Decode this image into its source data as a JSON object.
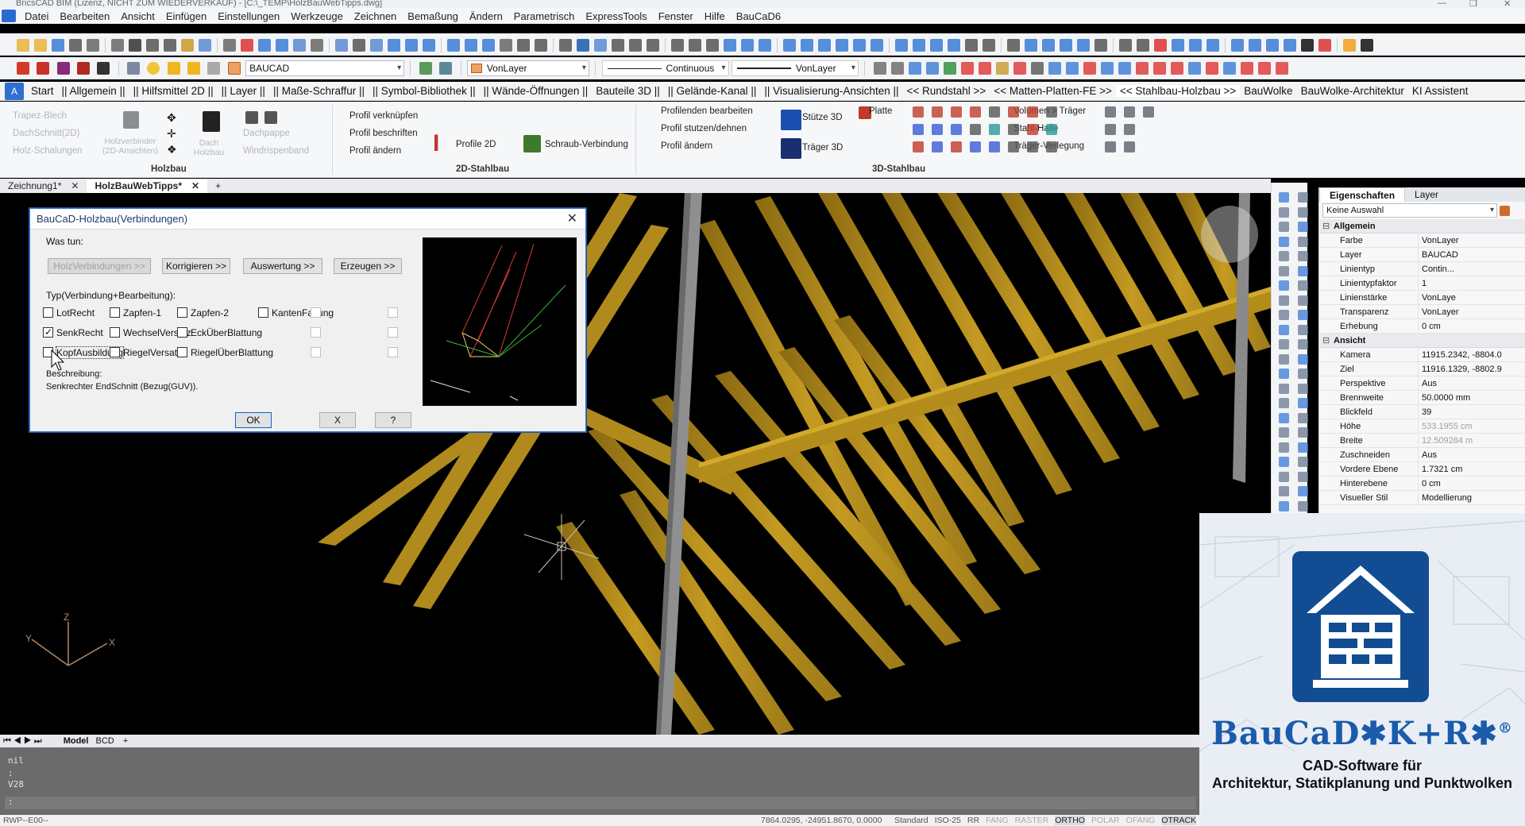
{
  "window": {
    "title": "BricsCAD BIM (Lizenz, NICHT ZUM WIEDERVERKAUF) - [C:\\_TEMP\\HolzBauWebTipps.dwg]"
  },
  "menu": [
    "Datei",
    "Bearbeiten",
    "Ansicht",
    "Einfügen",
    "Einstellungen",
    "Werkzeuge",
    "Zeichnen",
    "Bemaßung",
    "Ändern",
    "Parametrisch",
    "ExpressTools",
    "Fenster",
    "Hilfe",
    "BauCaD6"
  ],
  "toolbar2": {
    "layer": "BAUCAD",
    "color": "VonLayer",
    "linetype": "Continuous",
    "lineweight": "VonLayer"
  },
  "ribbon_tabs": [
    "Start",
    "|| Allgemein ||",
    "|| Hilfsmittel 2D ||",
    "|| Layer ||",
    "|| Maße-Schraffur ||",
    "|| Symbol-Bibliothek ||",
    "|| Wände-Öffnungen ||",
    "Bauteile 3D ||",
    "|| Gelände-Kanal ||",
    "|| Visualisierung-Ansichten ||",
    "<< Rundstahl >>",
    "<< Matten-Platten-FE >>",
    "<< Stahlbau-Holzbau >>",
    "BauWolke",
    "BauWolke-Architektur",
    "KI Assistent"
  ],
  "ribbon": {
    "holzbau": {
      "items": [
        "Trapez-Blech",
        "DachSchnitt(2D)",
        "Holz-Schalungen",
        "Holzverbinder (2D-Ansichten)",
        "Dach Holzbau",
        "Dachpappe",
        "Windrispenband"
      ],
      "group": "Holzbau"
    },
    "stahl2d": {
      "items": [
        "Profil verknüpfen",
        "Profil beschriften",
        "Profil ändern",
        "Profile 2D",
        "Schraub-Verbindung"
      ],
      "group": "2D-Stahlbau"
    },
    "stahl3d": {
      "items": [
        "Profilenden bearbeiten",
        "Profil stutzen/dehnen",
        "Profil ändern",
        "Stütze 3D",
        "Träger 3D",
        "Platte",
        "Volumen > Träger",
        "Stahl-Halle",
        "Träger-Verlegung"
      ],
      "group": "3D-Stahlbau"
    }
  },
  "doc_tabs": [
    {
      "label": "Zeichnung1*"
    },
    {
      "label": "HolzBauWebTipps*"
    }
  ],
  "dialog": {
    "title": "BauCaD-Holzbau(Verbindungen)",
    "was_tun": "Was tun:",
    "buttons": [
      "HolzVerbindungen >>",
      "Korrigieren >>",
      "Auswertung >>",
      "Erzeugen >>"
    ],
    "typ_label": "Typ(Verbindung+Bearbeitung):",
    "checks": [
      {
        "label": "LotRecht",
        "checked": false
      },
      {
        "label": "Zapfen-1",
        "checked": false
      },
      {
        "label": "Zapfen-2",
        "checked": false
      },
      {
        "label": "KantenFasung",
        "checked": false
      },
      {
        "label": "SenkRecht",
        "checked": true
      },
      {
        "label": "WechselVersatz",
        "checked": false
      },
      {
        "label": "EckÜberBlattung",
        "checked": false
      },
      {
        "label": "KopfAusbildung",
        "checked": false
      },
      {
        "label": "RiegelVersatz",
        "checked": false
      },
      {
        "label": "RiegelÜberBlattung",
        "checked": false
      }
    ],
    "beschreibung_label": "Beschreibung:",
    "beschreibung": "Senkrechter EndSchnitt (Bezug(GUV)).",
    "ok": "OK",
    "cancel": "X",
    "help": "?"
  },
  "properties": {
    "tabs": [
      "Eigenschaften",
      "Layer"
    ],
    "selection": "Keine Auswahl",
    "allgemein": "Allgemein",
    "general_rows": [
      [
        "Farbe",
        "VonLayer"
      ],
      [
        "Layer",
        "BAUCAD"
      ],
      [
        "Linientyp",
        "Contin..."
      ],
      [
        "Linientypfaktor",
        "1"
      ],
      [
        "Linienstärke",
        "VonLaye"
      ],
      [
        "Transparenz",
        "VonLayer"
      ],
      [
        "Erhebung",
        "0 cm"
      ]
    ],
    "ansicht": "Ansicht",
    "view_rows": [
      [
        "Kamera",
        "11915.2342, -8804.0"
      ],
      [
        "Ziel",
        "11916.1329, -8802.9"
      ],
      [
        "Perspektive",
        "Aus"
      ],
      [
        "Brennweite",
        "50.0000 mm"
      ],
      [
        "Blickfeld",
        "39"
      ],
      [
        "Höhe",
        "533.1955 cm"
      ],
      [
        "Breite",
        "12.509284 m"
      ],
      [
        "Zuschneiden",
        "Aus"
      ],
      [
        "Vordere Ebene",
        "1.7321 cm"
      ],
      [
        "Hinterebene",
        "0 cm"
      ],
      [
        "Visueller Stil",
        "Modellierung"
      ]
    ]
  },
  "layout_tabs": {
    "model": "Model",
    "other": "BCD",
    "add": "+"
  },
  "command": {
    "lines": [
      "nil",
      ":",
      "V28",
      ":"
    ]
  },
  "status": {
    "cmd": "RWP--E00--",
    "coords": "7864.0295, -24951.8670, 0.0000",
    "items": [
      "Standard",
      "ISO-25",
      "RR",
      "FANG",
      "RASTER",
      "ORTHO",
      "POLAR",
      "OFANG",
      "OTRACK"
    ]
  },
  "ucs": {
    "x": "X",
    "y": "Y",
    "z": "Z"
  },
  "brand": {
    "name": "BauCaD✱K+R✱",
    "reg": "®",
    "line1": "CAD-Software für",
    "line2": "Architektur, Statikplanung und Punktwolken"
  }
}
